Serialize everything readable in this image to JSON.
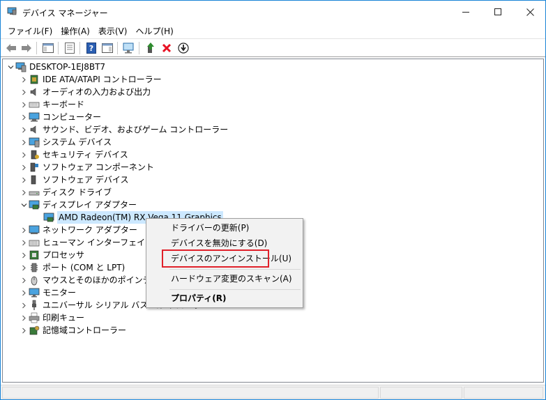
{
  "window": {
    "title": "デバイス マネージャー"
  },
  "menu": [
    {
      "label": "ファイル(F)"
    },
    {
      "label": "操作(A)"
    },
    {
      "label": "表示(V)"
    },
    {
      "label": "ヘルプ(H)"
    }
  ],
  "toolbar": {
    "buttons": [
      "back-icon",
      "forward-icon",
      "show-hide-console-tree-icon",
      "properties-icon",
      "help-icon",
      "action-pane-icon",
      "scan-hardware-icon",
      "update-driver-icon",
      "uninstall-icon",
      "download-icon"
    ]
  },
  "tree": {
    "root": "DESKTOP-1EJ8BT7",
    "items": [
      {
        "label": "IDE ATA/ATAPI コントローラー",
        "icon": "ide-controller-icon"
      },
      {
        "label": "オーディオの入力および出力",
        "icon": "audio-icon"
      },
      {
        "label": "キーボード",
        "icon": "keyboard-icon"
      },
      {
        "label": "コンピューター",
        "icon": "computer-icon"
      },
      {
        "label": "サウンド、ビデオ、およびゲーム コントローラー",
        "icon": "sound-icon"
      },
      {
        "label": "システム デバイス",
        "icon": "system-device-icon"
      },
      {
        "label": "セキュリティ デバイス",
        "icon": "security-device-icon"
      },
      {
        "label": "ソフトウェア コンポーネント",
        "icon": "software-component-icon"
      },
      {
        "label": "ソフトウェア デバイス",
        "icon": "software-device-icon"
      },
      {
        "label": "ディスク ドライブ",
        "icon": "disk-drive-icon"
      },
      {
        "label": "ディスプレイ アダプター",
        "icon": "display-adapter-icon",
        "expanded": true
      },
      {
        "label": "AMD Radeon(TM) RX Vega 11 Graphics",
        "icon": "display-adapter-icon",
        "child": true,
        "selected": true
      },
      {
        "label": "ネットワーク アダプター",
        "icon": "network-adapter-icon"
      },
      {
        "label": "ヒューマン インターフェイス デバイス",
        "icon": "hid-icon"
      },
      {
        "label": "プロセッサ",
        "icon": "processor-icon"
      },
      {
        "label": "ポート (COM と LPT)",
        "icon": "port-icon"
      },
      {
        "label": "マウスとそのほかのポインティング デバイス",
        "icon": "mouse-icon"
      },
      {
        "label": "モニター",
        "icon": "monitor-icon"
      },
      {
        "label": "ユニバーサル シリアル バス コントローラー",
        "icon": "usb-icon"
      },
      {
        "label": "印刷キュー",
        "icon": "print-queue-icon"
      },
      {
        "label": "記憶域コントローラー",
        "icon": "storage-controller-icon"
      }
    ]
  },
  "context_menu": {
    "items": [
      {
        "label": "ドライバーの更新(P)"
      },
      {
        "label": "デバイスを無効にする(D)"
      },
      {
        "label": "デバイスのアンインストール(U)",
        "highlighted": true
      },
      {
        "label": "ハードウェア変更のスキャン(A)"
      },
      {
        "label": "プロパティ(R)",
        "bold": true
      }
    ]
  },
  "colors": {
    "window_border": "#1883d7",
    "selection": "#cce8ff",
    "highlight_box": "#e0202a",
    "uninstall_red": "#e81123",
    "scan_green": "#2e8b2e"
  }
}
